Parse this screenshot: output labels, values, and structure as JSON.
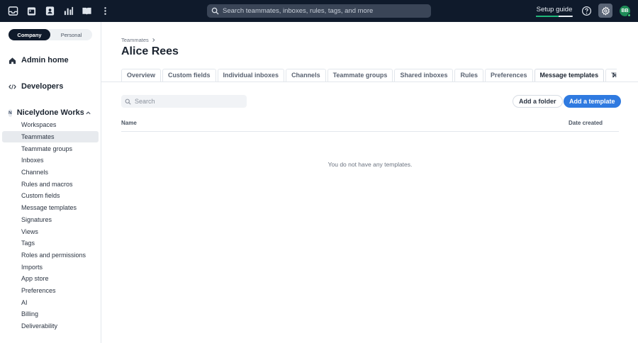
{
  "topbar": {
    "icons": [
      "inbox-icon",
      "calendar-icon",
      "contacts-icon",
      "analytics-icon",
      "knowledge-base-icon",
      "more-icon"
    ],
    "search_placeholder": "Search teammates, inboxes, rules, tags, and more",
    "setup_label": "Setup guide",
    "setup_progress": 0.62,
    "avatar_initials": "BB"
  },
  "sidebar": {
    "segment": {
      "company": "Company",
      "personal": "Personal"
    },
    "admin_home": "Admin home",
    "developers": "Developers",
    "workspace_badge": "N",
    "workspace_name": "Nicelydone Workspace",
    "items": [
      {
        "label": "Workspaces"
      },
      {
        "label": "Teammates"
      },
      {
        "label": "Teammate groups"
      },
      {
        "label": "Inboxes"
      },
      {
        "label": "Channels"
      },
      {
        "label": "Rules and macros"
      },
      {
        "label": "Custom fields"
      },
      {
        "label": "Message templates"
      },
      {
        "label": "Signatures"
      },
      {
        "label": "Views"
      },
      {
        "label": "Tags"
      },
      {
        "label": "Roles and permissions"
      },
      {
        "label": "Imports"
      },
      {
        "label": "App store"
      },
      {
        "label": "Preferences"
      },
      {
        "label": "AI"
      },
      {
        "label": "Billing"
      },
      {
        "label": "Deliverability"
      }
    ]
  },
  "main": {
    "breadcrumb": "Teammates",
    "title": "Alice Rees",
    "tabs": [
      {
        "label": "Overview"
      },
      {
        "label": "Custom fields"
      },
      {
        "label": "Individual inboxes"
      },
      {
        "label": "Channels"
      },
      {
        "label": "Teammate groups"
      },
      {
        "label": "Shared inboxes"
      },
      {
        "label": "Rules"
      },
      {
        "label": "Preferences"
      },
      {
        "label": "Message templates"
      },
      {
        "label": "Time off"
      }
    ],
    "search_placeholder": "Search",
    "add_folder": "Add a folder",
    "add_template": "Add a template",
    "col_name": "Name",
    "col_date": "Date created",
    "empty_text": "You do not have any templates."
  },
  "colors": {
    "topbar_bg": "#0f1a2b",
    "accent": "#2f7ae0",
    "progress": "#1fb87a",
    "avatar": "#1e8c57"
  }
}
